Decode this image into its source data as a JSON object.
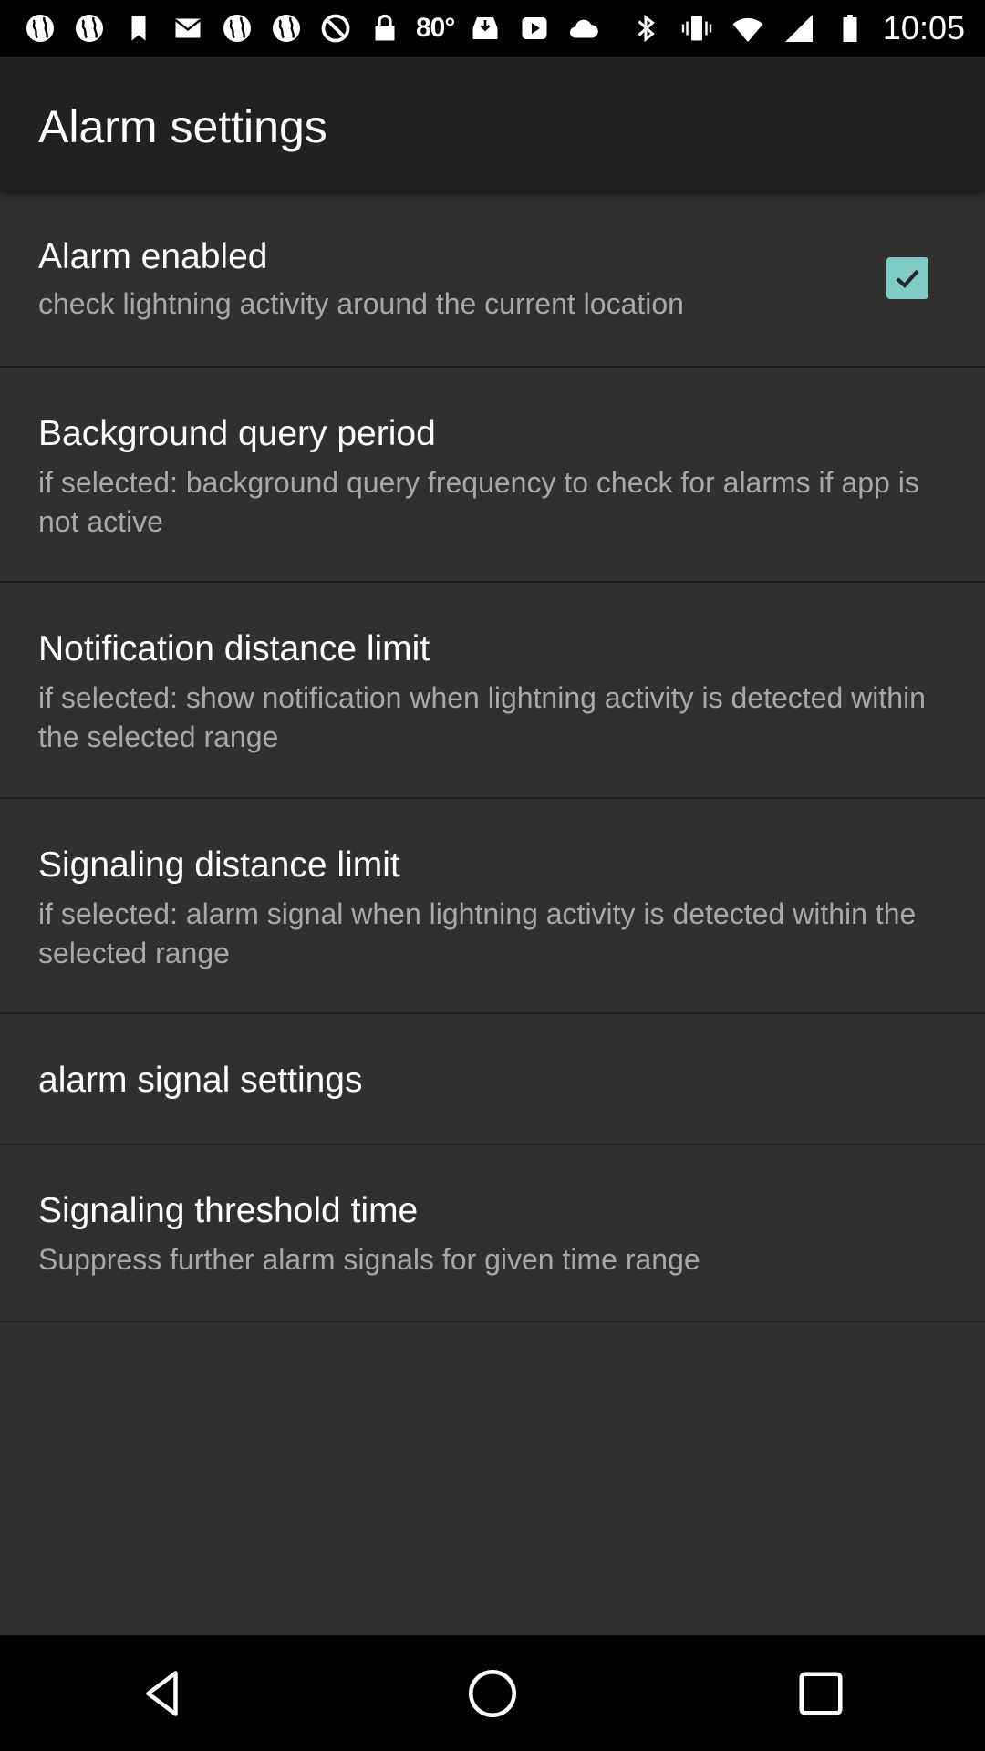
{
  "status_bar": {
    "notification_icons": [
      "globe-icon",
      "globe-icon",
      "bookmark-icon",
      "mail-icon",
      "globe-icon",
      "globe-icon",
      "blocked-icon",
      "lock-icon"
    ],
    "temperature": "80°",
    "right_icons": [
      "inbox-download-icon",
      "video-icon",
      "cloud-icon",
      "bluetooth-icon",
      "vibrate-icon",
      "wifi-icon",
      "signal-icon",
      "battery-icon"
    ],
    "time": "10:05"
  },
  "app_bar": {
    "title": "Alarm settings"
  },
  "settings": [
    {
      "title": "Alarm enabled",
      "summary": "check lightning activity around the current location",
      "has_checkbox": true,
      "checked": true
    },
    {
      "title": "Background query period",
      "summary": "if selected: background query frequency to check for alarms if app is not active"
    },
    {
      "title": "Notification distance limit",
      "summary": "if selected: show notification when lightning activity is detected within the selected range"
    },
    {
      "title": "Signaling distance limit",
      "summary": "if selected: alarm signal when lightning activity is detected within the selected range"
    },
    {
      "title": "alarm signal settings",
      "summary": ""
    },
    {
      "title": "Signaling threshold time",
      "summary": "Suppress further alarm signals for given time range"
    }
  ],
  "nav_bar": {
    "buttons": [
      "back-icon",
      "home-icon",
      "recents-icon"
    ]
  },
  "colors": {
    "background": "#303030",
    "app_bar": "#212121",
    "accent": "#80cbc4",
    "title_text": "#ffffff",
    "summary_text": "#a8a8a8"
  }
}
